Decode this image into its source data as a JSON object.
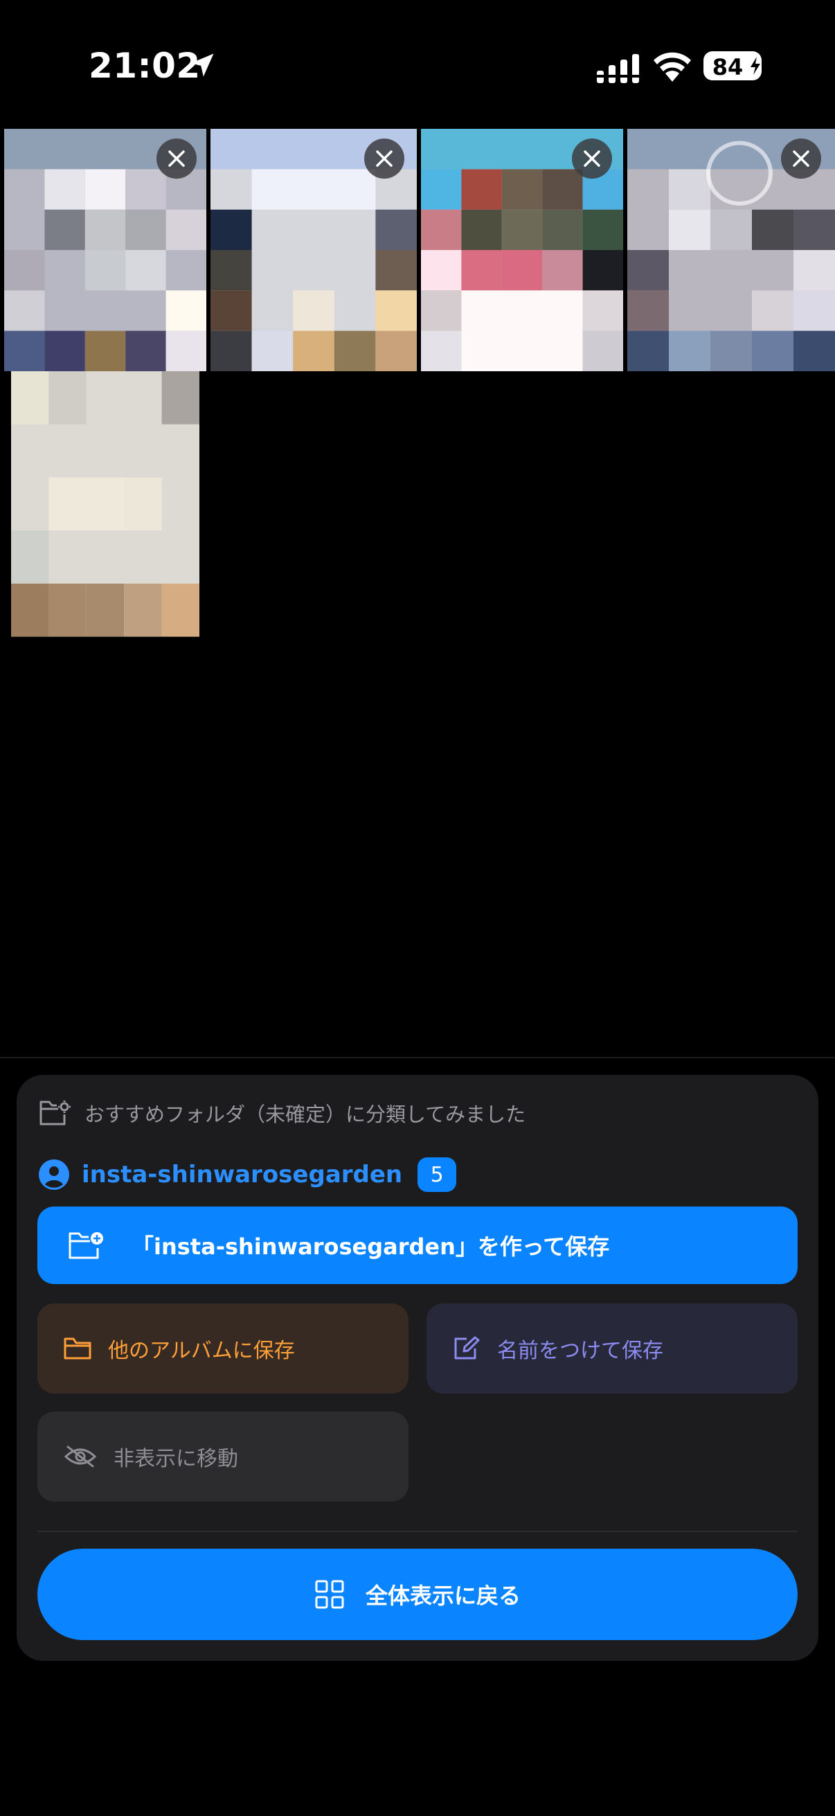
{
  "status_bar": {
    "time": "21:02",
    "battery": "84",
    "icons": [
      "location-arrow-icon",
      "cellular-signal-icon",
      "wifi-icon",
      "battery-charging-icon"
    ]
  },
  "photos": {
    "count_visible": 5,
    "remove_icon": "close-icon"
  },
  "panel": {
    "header_icon": "folder-settings-icon",
    "header_text": "おすすめフォルダ（未確定）に分類してみました",
    "account_icon": "person-circle-icon",
    "account_name": "insta-shinwarosegarden",
    "account_count": "5",
    "create_button": {
      "icon": "folder-add-icon",
      "label": "「insta-shinwarosegarden」を作って保存"
    },
    "save_other": {
      "icon": "folder-icon",
      "label": "他のアルバムに保存"
    },
    "save_named": {
      "icon": "edit-icon",
      "label": "名前をつけて保存"
    },
    "hide": {
      "icon": "eye-slash-icon",
      "label": "非表示に移動"
    },
    "back_button": {
      "icon": "grid-icon",
      "label": "全体表示に戻る"
    }
  },
  "colors": {
    "accent": "#0a84ff",
    "orange": "#ff9f3a",
    "indigo": "#8c8cf0",
    "panel_bg": "#1c1c1e"
  }
}
